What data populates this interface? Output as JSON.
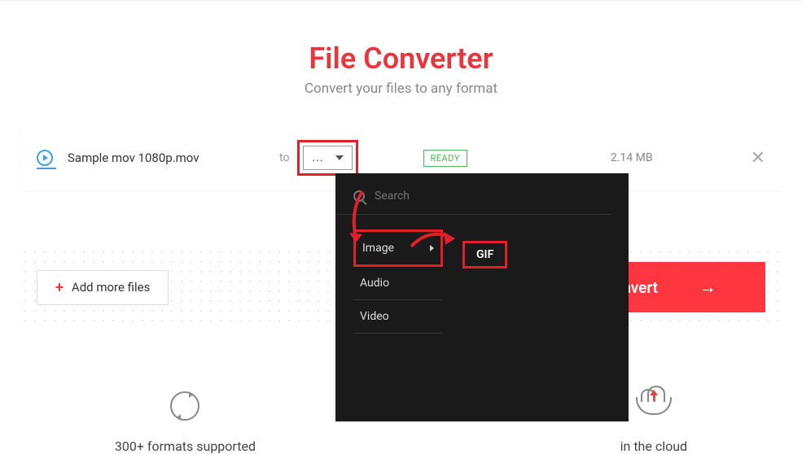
{
  "header": {
    "title": "File Converter",
    "subtitle": "Convert your files to any format"
  },
  "file": {
    "name": "Sample mov 1080p.mov",
    "to_label": "to",
    "format_placeholder": "...",
    "status": "READY",
    "size": "2.14 MB"
  },
  "actions": {
    "add_more": "Add more files",
    "convert": "onvert"
  },
  "dropdown": {
    "search_placeholder": "Search",
    "categories": [
      "Image",
      "Audio",
      "Video"
    ],
    "selected_format": "GIF"
  },
  "features": {
    "formats": "300+ formats supported",
    "cloud": "in the cloud"
  }
}
